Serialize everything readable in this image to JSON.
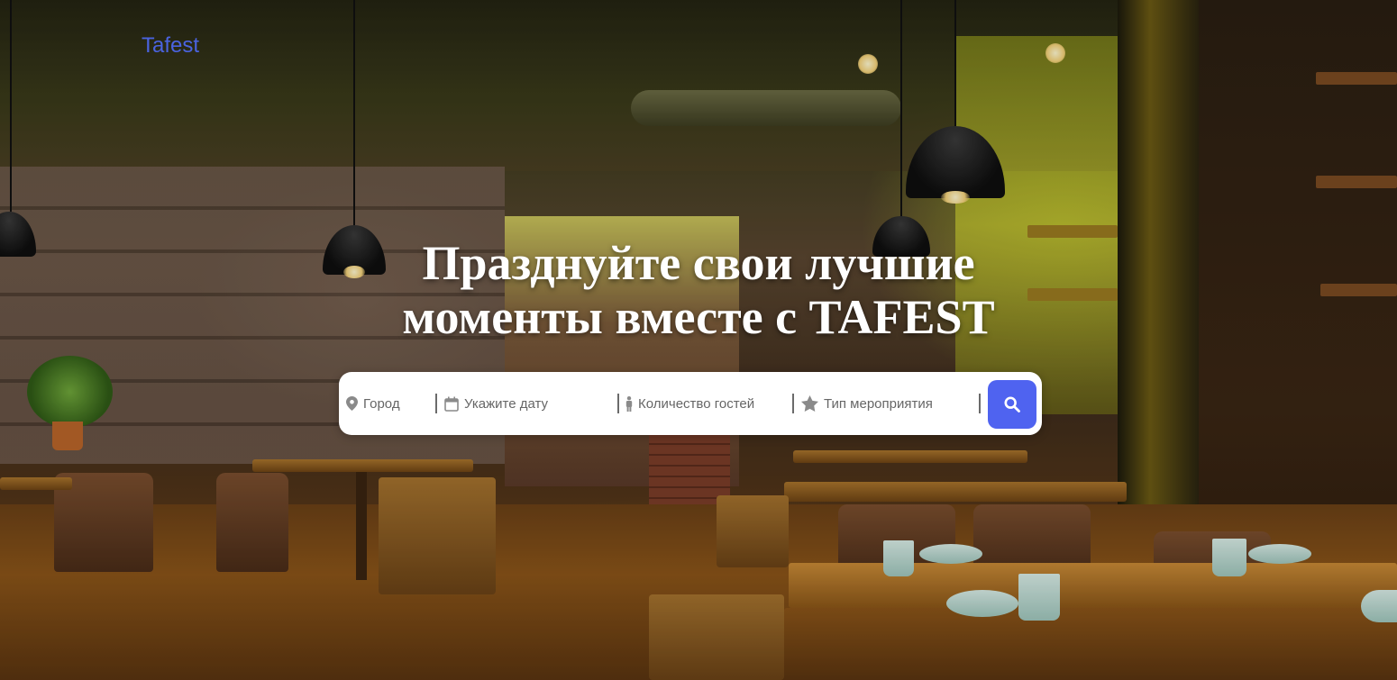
{
  "header": {
    "logo_text": "Tafest"
  },
  "hero": {
    "title_line1": "Празднуйте свои лучшие",
    "title_line2": "моменты вместе с TAFEST"
  },
  "search": {
    "city_label": "Город",
    "date_label": "Укажите дату",
    "guests_label": "Количество гостей",
    "event_type_label": "Тип мероприятия",
    "button_icon": "search-icon"
  },
  "colors": {
    "accent": "#4f63f0",
    "logo": "#4a63e0",
    "title": "#ffffff",
    "placeholder": "#666666"
  },
  "icons": {
    "city": "map-pin-icon",
    "date": "calendar-icon",
    "guests": "person-icon",
    "event_type": "star-icon"
  }
}
